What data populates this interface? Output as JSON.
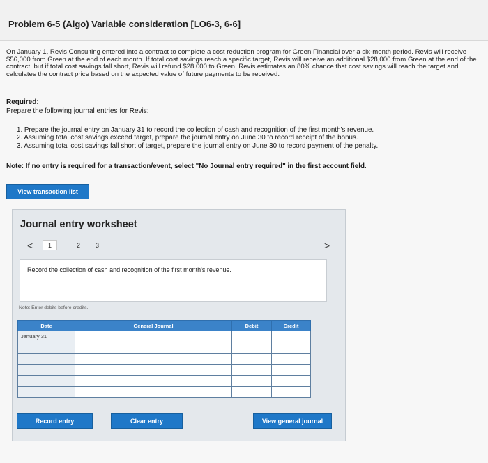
{
  "problem": {
    "title": "Problem 6-5 (Algo) Variable consideration [LO6-3, 6-6]",
    "paragraph": "On January 1, Revis Consulting entered into a contract to complete a cost reduction program for Green Financial over a six-month period. Revis will receive $56,000 from Green at the end of each month. If total cost savings reach a specific target, Revis will receive an additional $28,000 from Green at the end of the contract, but if total cost savings fall short, Revis will refund $28,000 to Green. Revis estimates an 80% chance that cost savings will reach the target and calculates the contract price based on the expected value of future payments to be received.",
    "required_label": "Required:",
    "required_text": "Prepare the following journal entries for Revis:",
    "requirements": [
      "1. Prepare the journal entry on January 31 to record the collection of cash and recognition of the first month's revenue.",
      "2. Assuming total cost savings exceed target, prepare the journal entry on June 30 to record receipt of the bonus.",
      "3. Assuming total cost savings fall short of target, prepare the journal entry on June 30 to record payment of the penalty."
    ],
    "note": "Note: If no entry is required for a transaction/event, select \"No Journal entry required\" in the first account field."
  },
  "view_transaction_list_label": "View transaction list",
  "worksheet": {
    "title": "Journal entry worksheet",
    "prev_arrow": "<",
    "next_arrow": ">",
    "pages": [
      "1",
      "2",
      "3"
    ],
    "instruction": "Record the collection of cash and recognition of the first month's revenue.",
    "note": "Note: Enter debits before credits.",
    "columns": [
      "Date",
      "General Journal",
      "Debit",
      "Credit"
    ],
    "rows": [
      {
        "date": "January 31"
      },
      {
        "date": ""
      },
      {
        "date": ""
      },
      {
        "date": ""
      },
      {
        "date": ""
      },
      {
        "date": ""
      }
    ]
  },
  "buttons": {
    "record_entry": "Record entry",
    "clear_entry": "Clear entry",
    "view_general_journal": "View general journal"
  },
  "colors": {
    "accent": "#1f78c8",
    "table_header": "#3b83c9"
  }
}
